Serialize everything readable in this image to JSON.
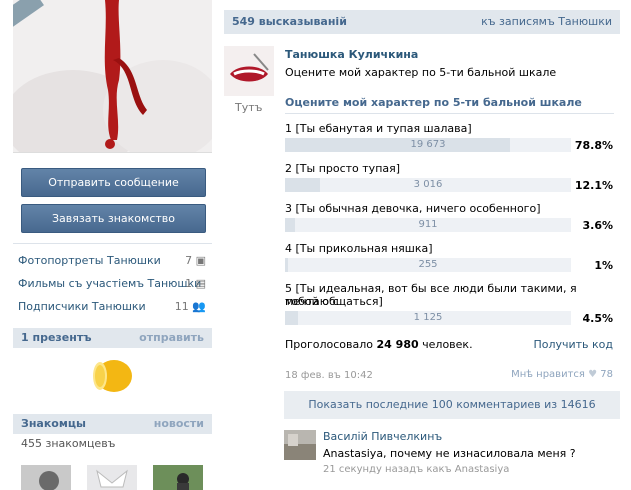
{
  "profile": {
    "actions": {
      "send_message": "Отправить сообщение",
      "befriend": "Завязать знакомство"
    },
    "links": [
      {
        "label": "Фотопортреты Танюшки",
        "count": "7"
      },
      {
        "label": "Фильмы съ участiемъ Танюшки",
        "count": "1"
      },
      {
        "label": "Подписчики Танюшки",
        "count": "11"
      }
    ],
    "gifts": {
      "title": "1 презентъ",
      "action": "отправить"
    },
    "friends": {
      "title": "Знакомцы",
      "action": "новости",
      "count_text": "455 знакомцевъ"
    }
  },
  "wall": {
    "header_left": "549 высказываній",
    "header_right": "къ записямъ Танюшки",
    "post": {
      "author": "Танюшка Куличкина",
      "text": "Оцените мой характер по 5-ти бальной шкале",
      "avatar_caption": "Тутъ"
    },
    "poll": {
      "title": "Оцените мой характер по 5-ти бальной шкале",
      "options": [
        {
          "label": "1 [Ты ебанутая и тупая шалава]",
          "votes": "19 673",
          "percent": "78.8%",
          "fraction": 0.788
        },
        {
          "label": "2 [Ты просто тупая]",
          "votes": "3 016",
          "percent": "12.1%",
          "fraction": 0.121
        },
        {
          "label": "3 [Ты обычная девочка, ничего особенного]",
          "votes": "911",
          "percent": "3.6%",
          "fraction": 0.036
        },
        {
          "label": "4 [Ты прикольная няшка]",
          "votes": "255",
          "percent": "1%",
          "fraction": 0.01
        },
        {
          "label_line1": "5 [Ты идеальная, вот бы все люди были такими, я мечтаю с",
          "label_line2": "тобой общаться]",
          "votes": "1 125",
          "percent": "4.5%",
          "fraction": 0.045
        }
      ],
      "total_prefix": "Проголосовало",
      "total_votes": "24 980",
      "total_suffix": "человек.",
      "get_code": "Получить код"
    },
    "meta": {
      "date": "18 фев. въ 10:42",
      "like_label": "Мнѣ нравится",
      "like_count": "78"
    },
    "show_comments": "Показать последние 100 комментариев из 14616",
    "comment": {
      "author": "Василій Пивчелкинъ",
      "text": "Anastasiya, почему не изнасиловала меня ?",
      "meta": "21 секунду назадъ какъ Anastasiya"
    }
  }
}
